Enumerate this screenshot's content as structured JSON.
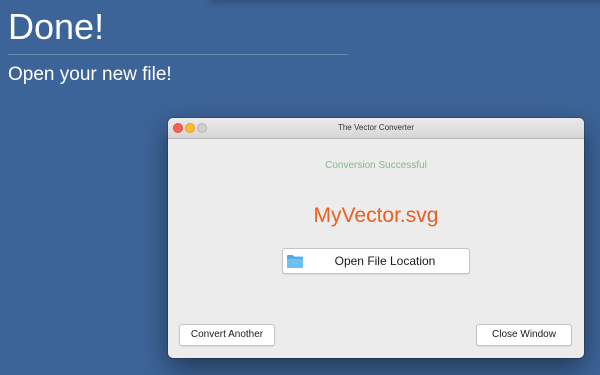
{
  "page": {
    "headline": "Done!",
    "subheadline": "Open your new file!",
    "background_color": "#3d6498"
  },
  "window": {
    "title": "The Vector Converter",
    "status_text": "Conversion Successful",
    "status_color": "#8ab88a",
    "filename": "MyVector.svg",
    "filename_color": "#ea6022",
    "open_button": {
      "label": "Open File Location",
      "icon": "folder-icon"
    },
    "convert_another_label": "Convert Another",
    "close_window_label": "Close Window"
  }
}
